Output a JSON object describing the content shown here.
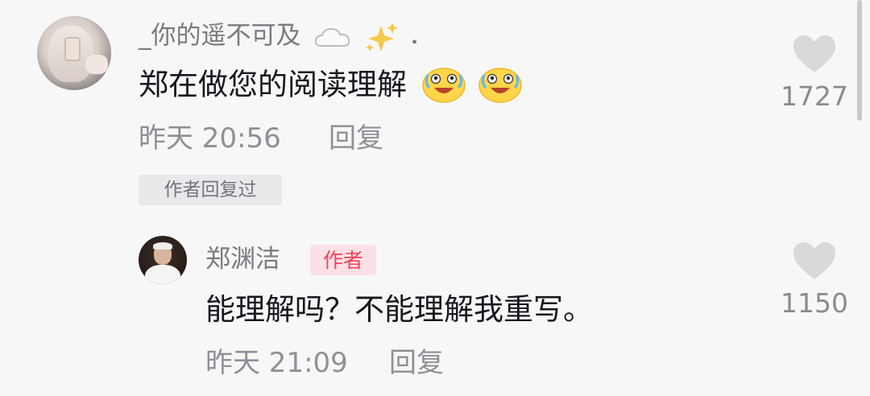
{
  "comment": {
    "username": "_你的遥不可及",
    "username_trail": "．",
    "username_icons": [
      "cloud-icon",
      "sparkles-icon"
    ],
    "text": "郑在做您的阅读理解",
    "text_emojis": [
      "laugh-cry-emoji",
      "laugh-cry-emoji"
    ],
    "time": "昨天 20:56",
    "reply_label": "回复",
    "like_count": "1727",
    "author_replied_badge": "作者回复过"
  },
  "reply": {
    "username": "郑渊洁",
    "author_tag": "作者",
    "text": "能理解吗？不能理解我重写。",
    "time": "昨天 21:09",
    "reply_label": "回复",
    "like_count": "1150"
  },
  "colors": {
    "background": "#f7f7f8",
    "author_tag_text": "#f2435b",
    "author_tag_bg": "#fbe1e5",
    "heart": "#d9d9dc"
  }
}
